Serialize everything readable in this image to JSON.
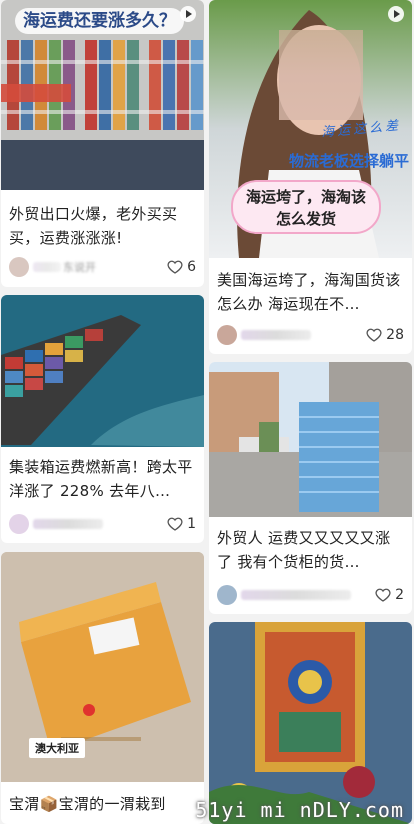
{
  "watermark": "51yi mi nDLY.com",
  "cards": [
    {
      "overlay_title": "海运费还要涨多久？",
      "title": "外贸出口火爆，老外买买买，运费涨涨涨!",
      "user": "东说开",
      "likes": "6"
    },
    {
      "cursive_text": "海运这么差",
      "overlay_sub": "物流老板选择躺平",
      "bubble_line1": "海运垮了，海淘该",
      "bubble_line2": "怎么发货",
      "title": "美国海运垮了，海淘国货该怎么办 海运现在不…",
      "likes": "28"
    },
    {
      "title": "集装箱运费燃新高！跨太平洋涨了 228% 去年八…",
      "likes": "1"
    },
    {
      "title": "外贸人 运费又又又又又涨了 我有个货柜的货…",
      "likes": "2"
    },
    {
      "label": "澳大利亚",
      "title": "宝渭📦宝渭的一渭栽到"
    },
    {}
  ]
}
